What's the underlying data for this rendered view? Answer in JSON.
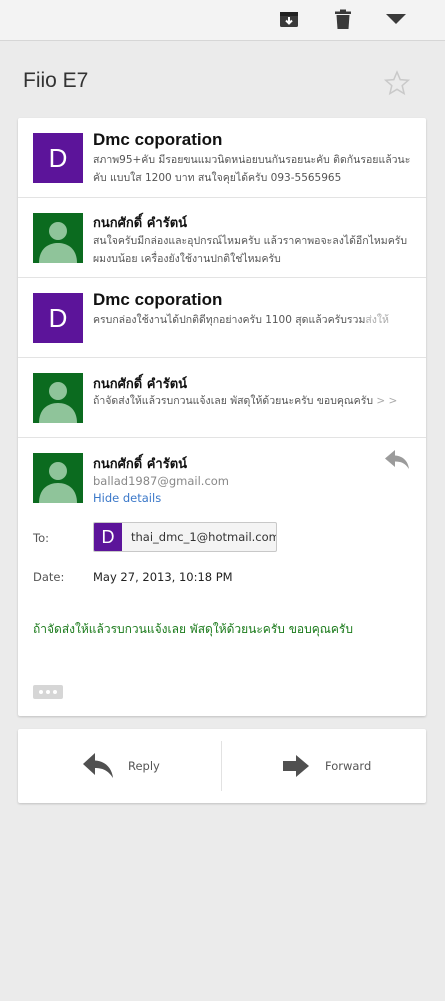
{
  "toolbar": {
    "archive_icon": "archive-icon",
    "delete_icon": "trash-icon",
    "more_icon": "dropdown-arrow-icon"
  },
  "subject": "Fiio E7",
  "messages": [
    {
      "sender": "Dmc coporation",
      "avatar_letter": "D",
      "snippet": "สภาพ95+คับ มีรอยขนแมวนิดหน่อยบนกันรอยนะคับ ติดกันรอยแล้วนะคับ แบบใส 1200 บาท สนใจคุยได้ครับ 093-5565965"
    },
    {
      "sender": "กนกศักดิ์ คำรัตน์",
      "snippet": "สนใจครับมีกล่องและอุปกรณ์ไหมครับ แล้วราคาพอจะลงได้อีกไหมครับผมงบน้อย เครื่องยังใช้งานปกติใช่ไหมครับ"
    },
    {
      "sender": "Dmc coporation",
      "avatar_letter": "D",
      "snippet": "ครบกล่องใช้งานได้ปกติดีทุกอย่างครับ 1100 สุดแล้วครับรวม",
      "snippet_fade": "ส่งให้"
    },
    {
      "sender": "กนกศักดิ์ คำรัตน์",
      "snippet": "ถ้าจัดส่งให้แล้วรบกวนแจ้งเลย พัสดุให้ด้วยนะครับ ขอบคุณครับ",
      "snippet_fade": " > >"
    }
  ],
  "expanded": {
    "sender": "กนกศักดิ์ คำรัตน์",
    "email": "ballad1987@gmail.com",
    "hide_details": "Hide details",
    "to_label": "To:",
    "to_avatar_letter": "D",
    "to_address": "thai_dmc_1@hotmail.com",
    "date_label": "Date:",
    "date_value": "May 27, 2013, 10:18 PM",
    "body": "ถ้าจัดส่งให้แล้วรบกวนแจ้งเลย พัสดุให้ด้วยนะครับ ขอบคุณครับ"
  },
  "actions": {
    "reply": "Reply",
    "forward": "Forward"
  },
  "colors": {
    "avatar_purple": "#5c149a",
    "avatar_green": "#0b6b1f",
    "link_blue": "#3b78c9",
    "body_green": "#1a7a1a"
  }
}
